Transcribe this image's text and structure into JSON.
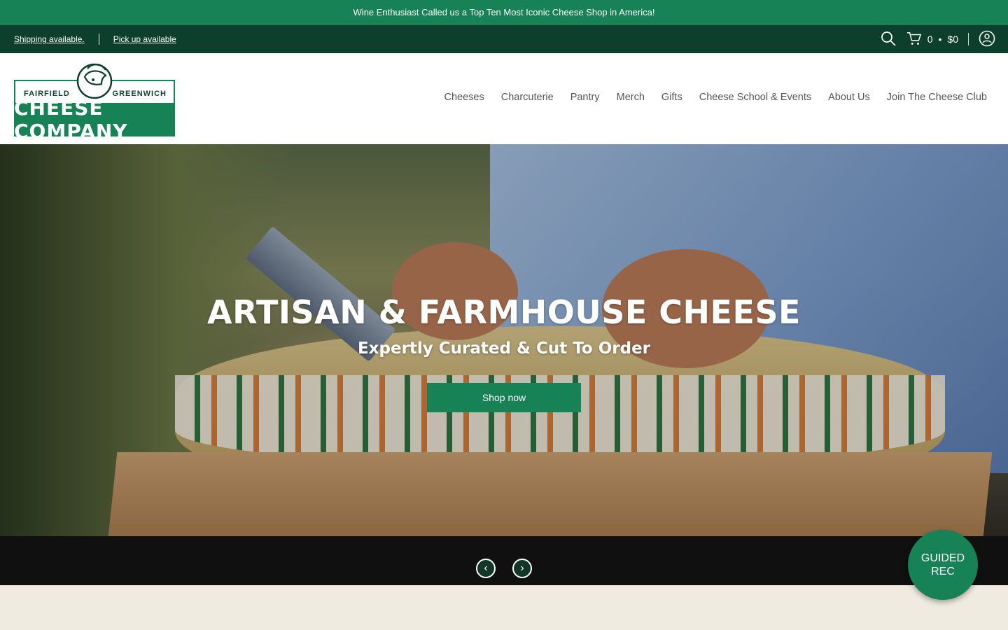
{
  "announcement": {
    "text": "Wine Enthusiast Called us a Top Ten Most Iconic Cheese Shop in America!"
  },
  "utility": {
    "shipping_link": "Shipping available.",
    "pickup_link": "Pick up available",
    "cart_count": "0",
    "cart_dot": "•",
    "cart_total": "$0"
  },
  "logo": {
    "left_text": "FAIRFIELD",
    "right_text": "GREENWICH",
    "main_text": "CHEESE COMPANY"
  },
  "nav": {
    "items": [
      "Cheeses",
      "Charcuterie",
      "Pantry",
      "Merch",
      "Gifts",
      "Cheese School & Events",
      "About Us",
      "Join The Cheese Club"
    ]
  },
  "hero": {
    "title": "ARTISAN & FARMHOUSE CHEESE",
    "subtitle": "Expertly Curated & Cut To Order",
    "cta": "Shop now",
    "prev_glyph": "‹",
    "next_glyph": "›"
  },
  "guided": {
    "line1": "GUIDED",
    "line2": "REC"
  },
  "colors": {
    "brand_green": "#168255",
    "dark_green": "#0d3f2d",
    "cream": "#efebe0"
  },
  "icons": [
    "search-icon",
    "cart-icon",
    "account-icon",
    "chevron-left-icon",
    "chevron-right-icon"
  ]
}
